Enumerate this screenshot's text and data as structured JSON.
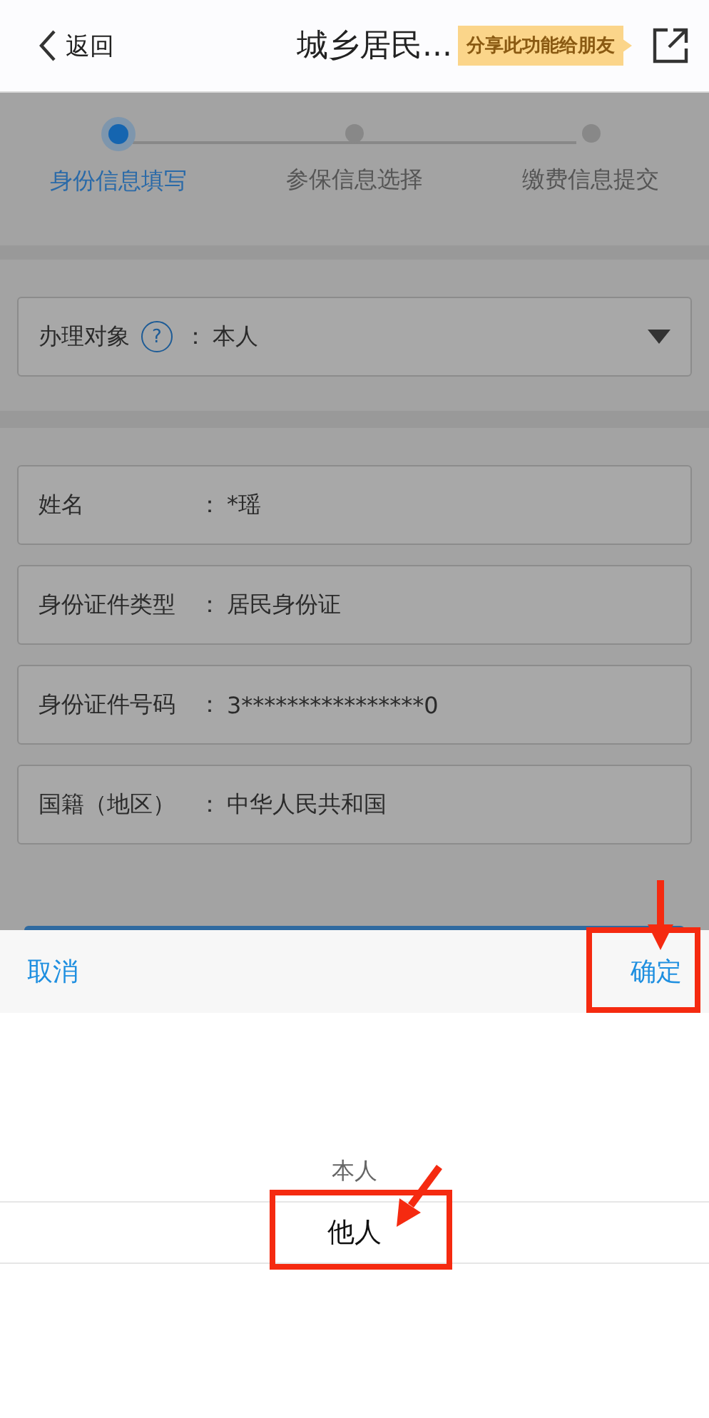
{
  "header": {
    "back": "返回",
    "title": "城乡居民...",
    "share_tip": "分享此功能给朋友"
  },
  "steps": [
    {
      "label": "身份信息填写",
      "selected": true
    },
    {
      "label": "参保信息选择",
      "selected": false
    },
    {
      "label": "缴费信息提交",
      "selected": false
    }
  ],
  "subject": {
    "label": "办理对象",
    "help": "?",
    "separator": "：",
    "value": "本人"
  },
  "fields": [
    {
      "label": "姓名",
      "separator": "：",
      "value": "*瑶"
    },
    {
      "label": "身份证件类型",
      "separator": "：",
      "value": "居民身份证"
    },
    {
      "label": "身份证件号码",
      "separator": "：",
      "value": "3****************0"
    },
    {
      "label": "国籍（地区）",
      "separator": "：",
      "value": "中华人民共和国"
    }
  ],
  "picker": {
    "cancel": "取消",
    "confirm": "确定",
    "options": [
      {
        "label": "本人",
        "selected": false
      },
      {
        "label": "他人",
        "selected": true
      }
    ]
  }
}
